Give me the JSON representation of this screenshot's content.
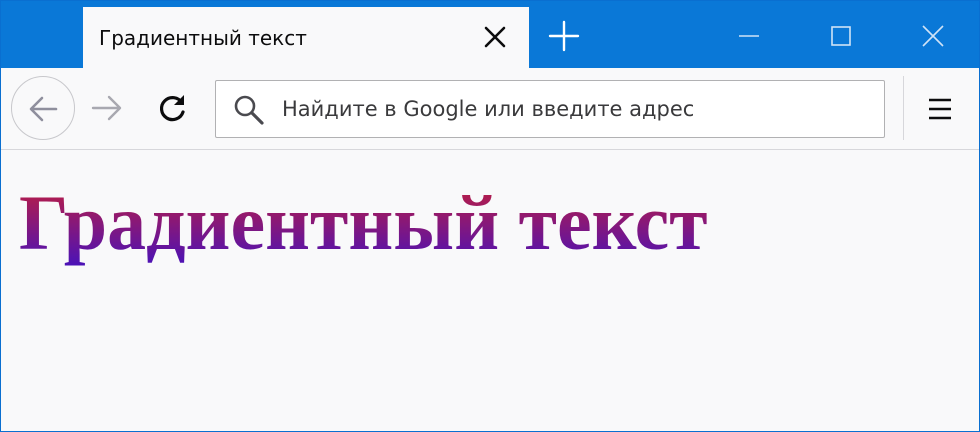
{
  "browser": {
    "tab": {
      "title": "Градиентный текст",
      "close_icon": "close-icon"
    },
    "new_tab_icon": "plus-icon",
    "window_controls": [
      "minimize-icon",
      "maximize-icon",
      "close-icon"
    ],
    "toolbar": {
      "back_icon": "arrow-left-icon",
      "forward_icon": "arrow-right-icon",
      "reload_icon": "reload-icon",
      "search_icon": "search-icon",
      "url_placeholder": "Найдите в Google или введите адрес",
      "url_value": "",
      "menu_icon": "hamburger-icon"
    },
    "colors": {
      "titlebar": "#0a78d7",
      "tab_bg": "#f9f9fa",
      "gradient_top": "#c41e3a",
      "gradient_bottom": "#4a12b8"
    }
  },
  "page": {
    "heading": "Градиентный текст"
  }
}
